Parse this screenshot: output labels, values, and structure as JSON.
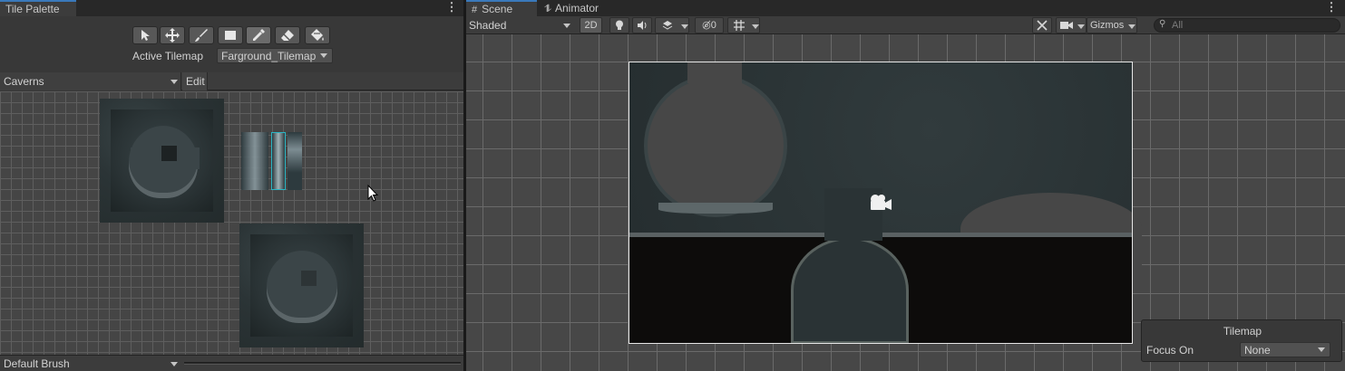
{
  "tile_palette": {
    "tab_label": "Tile Palette",
    "tools": [
      {
        "name": "select-tool",
        "icon": "arrow-cursor-icon"
      },
      {
        "name": "move-tool",
        "icon": "move-arrows-icon"
      },
      {
        "name": "paint-tool",
        "icon": "brush-icon"
      },
      {
        "name": "box-fill-tool",
        "icon": "rectangle-icon"
      },
      {
        "name": "picker-tool",
        "icon": "eyedropper-icon"
      },
      {
        "name": "erase-tool",
        "icon": "eraser-icon"
      },
      {
        "name": "fill-tool",
        "icon": "paint-bucket-icon"
      }
    ],
    "active_tilemap_label": "Active Tilemap",
    "active_tilemap_value": "Farground_Tilemap",
    "palette_value": "Caverns",
    "edit_label": "Edit",
    "brush_value": "Default Brush"
  },
  "scene": {
    "tab_scene": "Scene",
    "tab_animator": "Animator",
    "shading_mode": "Shaded",
    "btn_2d": "2D",
    "hidden_count": "0",
    "gizmos_label": "Gizmos",
    "search_placeholder": "All",
    "overlay": {
      "title": "Tilemap",
      "focus_label": "Focus On",
      "focus_value": "None"
    }
  },
  "colors": {
    "accent": "#3a79bb",
    "selection": "#2bb6c4",
    "panel": "#383838"
  }
}
